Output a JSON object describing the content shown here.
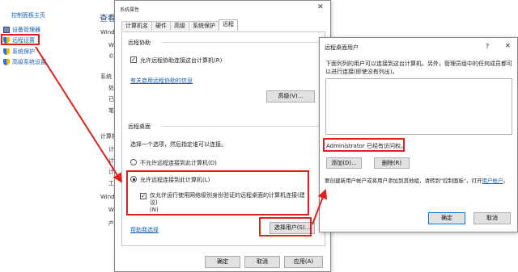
{
  "control_panel": {
    "home_link": "控制面板主页",
    "links": [
      {
        "label": "设备管理器",
        "icon": "device-manager-icon"
      },
      {
        "label": "远程设置",
        "icon": "shield-icon"
      },
      {
        "label": "系统保护",
        "icon": "shield-icon"
      },
      {
        "label": "高级系统设置",
        "icon": "shield-icon"
      }
    ],
    "title_fragment": "查看",
    "side_fragments": [
      "Wind",
      "W",
      "©",
      "系统",
      "处",
      "已",
      "笔",
      "计算机",
      "计",
      "计",
      "计",
      "工",
      "Wind",
      "W",
      "产"
    ]
  },
  "system_properties": {
    "title": "系统属性",
    "close_glyph": "✕",
    "tabs": [
      "计算机名",
      "硬件",
      "高级",
      "系统保护",
      "远程"
    ],
    "active_tab": "远程",
    "remote_assistance": {
      "group_title": "远程协助",
      "allow_checkbox_label": "允许远程协助连接这台计算机(R)",
      "allow_checked": true,
      "info_link": "有关启用远程协助的信息",
      "advanced_button": "高级(V)..."
    },
    "remote_desktop": {
      "group_title": "远程桌面",
      "prompt": "选择一个选项，然后指定谁可以连接。",
      "option_deny": "不允许远程连接到此计算机(D)",
      "option_allow": "允许远程连接到此计算机(L)",
      "selected_option": "allow",
      "nla_checkbox_label": "仅允许运行使用网络级别身份验证的远程桌面的计算机连接(建议)",
      "nla_checkbox_suffix": "(N)",
      "nla_checked": true,
      "help_link": "帮助我选择",
      "select_users_button": "选择用户(S)..."
    },
    "footer_buttons": {
      "ok": "确定",
      "cancel": "取消",
      "apply": "应用(A)"
    }
  },
  "remote_desktop_users": {
    "title": "远程桌面用户",
    "help_glyph": "?",
    "close_glyph": "✕",
    "description": "下面列列的用户可以连接到这台计算机。另外，管理员组中的任何成员都可以进行连接(即使没有列出)。",
    "users": [],
    "access_status": "Administrator 已经有访问权。",
    "add_button": "添加(D)...",
    "remove_button": "删除(R)",
    "footer_text": "要创建新用户帐户或将用户添加到其他组，请转到\"控制面板\"，打开",
    "footer_link": "用户帐户",
    "footer_period": "。",
    "ok_button": "确定",
    "cancel_button": "取消"
  },
  "colors": {
    "highlight_red": "#e0201b",
    "link_blue": "#1a5fb4"
  }
}
